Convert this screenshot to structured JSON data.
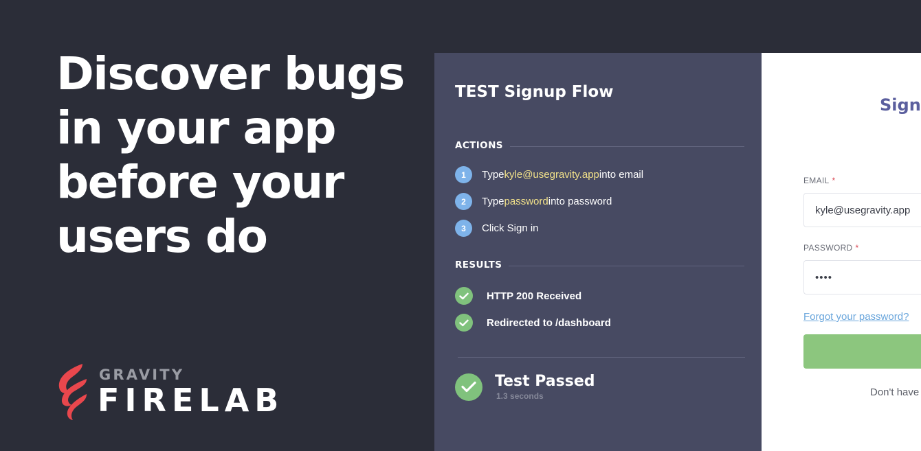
{
  "headline": {
    "lines": [
      "Discover bugs",
      "in your app",
      "before your",
      "users do"
    ]
  },
  "logo": {
    "top_word": "GRAVITY",
    "bottom_word": "FIRELAB",
    "icon": "flame-icon",
    "flame_color": "#e9474d"
  },
  "test_panel": {
    "title": "TEST Signup Flow",
    "actions_heading": "ACTIONS",
    "actions": [
      {
        "num": "1",
        "pre": "Type ",
        "highlight": "kyle@usegravity.app",
        "post": " into email"
      },
      {
        "num": "2",
        "pre": "Type ",
        "highlight": "password",
        "post": " into password"
      },
      {
        "num": "3",
        "pre": "Click Sign in",
        "highlight": "",
        "post": ""
      }
    ],
    "results_heading": "RESULTS",
    "results": [
      "HTTP 200 Received",
      "Redirected to /dashboard"
    ],
    "status": "Test Passed",
    "duration": "1.3 seconds",
    "colors": {
      "highlight": "#f3e28a",
      "success": "#80c27d",
      "step": "#7eb3ea"
    }
  },
  "signin": {
    "title": "Sign i",
    "email_label": "EMAIL",
    "password_label": "PASSWORD",
    "required_mark": "*",
    "email_value": "kyle@usegravity.app",
    "password_value": "••••",
    "forgot_link": "Forgot your password?",
    "no_account_text": "Don't have",
    "button_color": "#8cc67e"
  }
}
